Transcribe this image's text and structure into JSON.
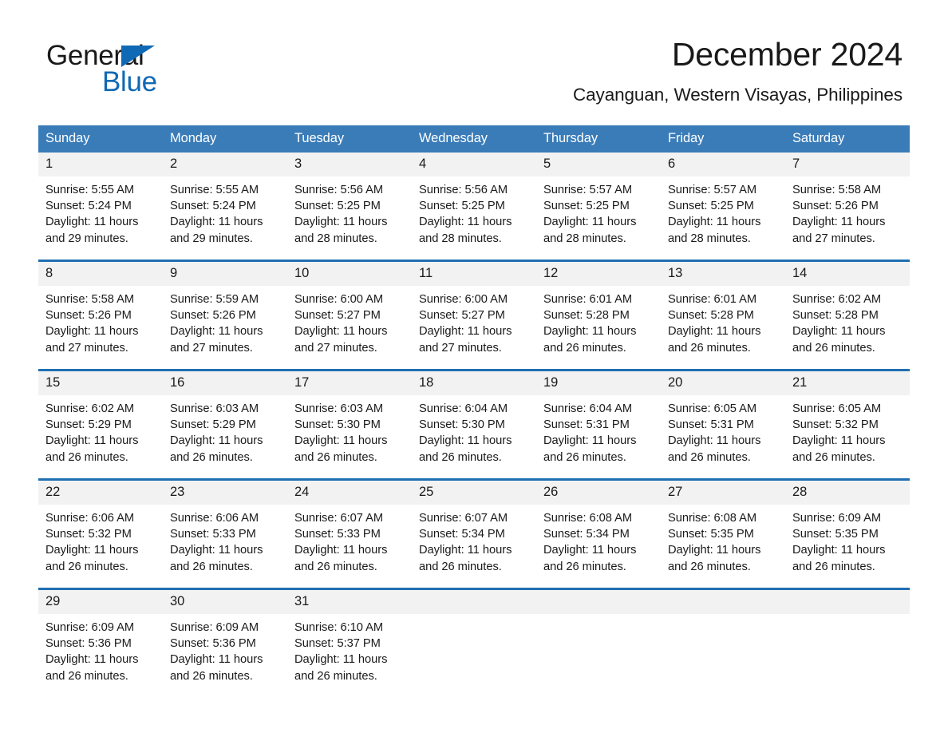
{
  "brand": {
    "name_part1": "General",
    "name_part2": "Blue",
    "accent_color": "#1069b4",
    "triangle_icon": "triangle-icon"
  },
  "header": {
    "month_title": "December 2024",
    "location": "Cayanguan, Western Visayas, Philippines"
  },
  "calendar": {
    "header_bg": "#3a7cb8",
    "row_divider_color": "#1f6fb2",
    "daynum_bg": "#f2f2f2",
    "weekdays": [
      "Sunday",
      "Monday",
      "Tuesday",
      "Wednesday",
      "Thursday",
      "Friday",
      "Saturday"
    ],
    "weeks": [
      [
        {
          "day": "1",
          "sunrise": "Sunrise: 5:55 AM",
          "sunset": "Sunset: 5:24 PM",
          "daylight_line1": "Daylight: 11 hours",
          "daylight_line2": "and 29 minutes."
        },
        {
          "day": "2",
          "sunrise": "Sunrise: 5:55 AM",
          "sunset": "Sunset: 5:24 PM",
          "daylight_line1": "Daylight: 11 hours",
          "daylight_line2": "and 29 minutes."
        },
        {
          "day": "3",
          "sunrise": "Sunrise: 5:56 AM",
          "sunset": "Sunset: 5:25 PM",
          "daylight_line1": "Daylight: 11 hours",
          "daylight_line2": "and 28 minutes."
        },
        {
          "day": "4",
          "sunrise": "Sunrise: 5:56 AM",
          "sunset": "Sunset: 5:25 PM",
          "daylight_line1": "Daylight: 11 hours",
          "daylight_line2": "and 28 minutes."
        },
        {
          "day": "5",
          "sunrise": "Sunrise: 5:57 AM",
          "sunset": "Sunset: 5:25 PM",
          "daylight_line1": "Daylight: 11 hours",
          "daylight_line2": "and 28 minutes."
        },
        {
          "day": "6",
          "sunrise": "Sunrise: 5:57 AM",
          "sunset": "Sunset: 5:25 PM",
          "daylight_line1": "Daylight: 11 hours",
          "daylight_line2": "and 28 minutes."
        },
        {
          "day": "7",
          "sunrise": "Sunrise: 5:58 AM",
          "sunset": "Sunset: 5:26 PM",
          "daylight_line1": "Daylight: 11 hours",
          "daylight_line2": "and 27 minutes."
        }
      ],
      [
        {
          "day": "8",
          "sunrise": "Sunrise: 5:58 AM",
          "sunset": "Sunset: 5:26 PM",
          "daylight_line1": "Daylight: 11 hours",
          "daylight_line2": "and 27 minutes."
        },
        {
          "day": "9",
          "sunrise": "Sunrise: 5:59 AM",
          "sunset": "Sunset: 5:26 PM",
          "daylight_line1": "Daylight: 11 hours",
          "daylight_line2": "and 27 minutes."
        },
        {
          "day": "10",
          "sunrise": "Sunrise: 6:00 AM",
          "sunset": "Sunset: 5:27 PM",
          "daylight_line1": "Daylight: 11 hours",
          "daylight_line2": "and 27 minutes."
        },
        {
          "day": "11",
          "sunrise": "Sunrise: 6:00 AM",
          "sunset": "Sunset: 5:27 PM",
          "daylight_line1": "Daylight: 11 hours",
          "daylight_line2": "and 27 minutes."
        },
        {
          "day": "12",
          "sunrise": "Sunrise: 6:01 AM",
          "sunset": "Sunset: 5:28 PM",
          "daylight_line1": "Daylight: 11 hours",
          "daylight_line2": "and 26 minutes."
        },
        {
          "day": "13",
          "sunrise": "Sunrise: 6:01 AM",
          "sunset": "Sunset: 5:28 PM",
          "daylight_line1": "Daylight: 11 hours",
          "daylight_line2": "and 26 minutes."
        },
        {
          "day": "14",
          "sunrise": "Sunrise: 6:02 AM",
          "sunset": "Sunset: 5:28 PM",
          "daylight_line1": "Daylight: 11 hours",
          "daylight_line2": "and 26 minutes."
        }
      ],
      [
        {
          "day": "15",
          "sunrise": "Sunrise: 6:02 AM",
          "sunset": "Sunset: 5:29 PM",
          "daylight_line1": "Daylight: 11 hours",
          "daylight_line2": "and 26 minutes."
        },
        {
          "day": "16",
          "sunrise": "Sunrise: 6:03 AM",
          "sunset": "Sunset: 5:29 PM",
          "daylight_line1": "Daylight: 11 hours",
          "daylight_line2": "and 26 minutes."
        },
        {
          "day": "17",
          "sunrise": "Sunrise: 6:03 AM",
          "sunset": "Sunset: 5:30 PM",
          "daylight_line1": "Daylight: 11 hours",
          "daylight_line2": "and 26 minutes."
        },
        {
          "day": "18",
          "sunrise": "Sunrise: 6:04 AM",
          "sunset": "Sunset: 5:30 PM",
          "daylight_line1": "Daylight: 11 hours",
          "daylight_line2": "and 26 minutes."
        },
        {
          "day": "19",
          "sunrise": "Sunrise: 6:04 AM",
          "sunset": "Sunset: 5:31 PM",
          "daylight_line1": "Daylight: 11 hours",
          "daylight_line2": "and 26 minutes."
        },
        {
          "day": "20",
          "sunrise": "Sunrise: 6:05 AM",
          "sunset": "Sunset: 5:31 PM",
          "daylight_line1": "Daylight: 11 hours",
          "daylight_line2": "and 26 minutes."
        },
        {
          "day": "21",
          "sunrise": "Sunrise: 6:05 AM",
          "sunset": "Sunset: 5:32 PM",
          "daylight_line1": "Daylight: 11 hours",
          "daylight_line2": "and 26 minutes."
        }
      ],
      [
        {
          "day": "22",
          "sunrise": "Sunrise: 6:06 AM",
          "sunset": "Sunset: 5:32 PM",
          "daylight_line1": "Daylight: 11 hours",
          "daylight_line2": "and 26 minutes."
        },
        {
          "day": "23",
          "sunrise": "Sunrise: 6:06 AM",
          "sunset": "Sunset: 5:33 PM",
          "daylight_line1": "Daylight: 11 hours",
          "daylight_line2": "and 26 minutes."
        },
        {
          "day": "24",
          "sunrise": "Sunrise: 6:07 AM",
          "sunset": "Sunset: 5:33 PM",
          "daylight_line1": "Daylight: 11 hours",
          "daylight_line2": "and 26 minutes."
        },
        {
          "day": "25",
          "sunrise": "Sunrise: 6:07 AM",
          "sunset": "Sunset: 5:34 PM",
          "daylight_line1": "Daylight: 11 hours",
          "daylight_line2": "and 26 minutes."
        },
        {
          "day": "26",
          "sunrise": "Sunrise: 6:08 AM",
          "sunset": "Sunset: 5:34 PM",
          "daylight_line1": "Daylight: 11 hours",
          "daylight_line2": "and 26 minutes."
        },
        {
          "day": "27",
          "sunrise": "Sunrise: 6:08 AM",
          "sunset": "Sunset: 5:35 PM",
          "daylight_line1": "Daylight: 11 hours",
          "daylight_line2": "and 26 minutes."
        },
        {
          "day": "28",
          "sunrise": "Sunrise: 6:09 AM",
          "sunset": "Sunset: 5:35 PM",
          "daylight_line1": "Daylight: 11 hours",
          "daylight_line2": "and 26 minutes."
        }
      ],
      [
        {
          "day": "29",
          "sunrise": "Sunrise: 6:09 AM",
          "sunset": "Sunset: 5:36 PM",
          "daylight_line1": "Daylight: 11 hours",
          "daylight_line2": "and 26 minutes."
        },
        {
          "day": "30",
          "sunrise": "Sunrise: 6:09 AM",
          "sunset": "Sunset: 5:36 PM",
          "daylight_line1": "Daylight: 11 hours",
          "daylight_line2": "and 26 minutes."
        },
        {
          "day": "31",
          "sunrise": "Sunrise: 6:10 AM",
          "sunset": "Sunset: 5:37 PM",
          "daylight_line1": "Daylight: 11 hours",
          "daylight_line2": "and 26 minutes."
        },
        {
          "day": "",
          "sunrise": "",
          "sunset": "",
          "daylight_line1": "",
          "daylight_line2": ""
        },
        {
          "day": "",
          "sunrise": "",
          "sunset": "",
          "daylight_line1": "",
          "daylight_line2": ""
        },
        {
          "day": "",
          "sunrise": "",
          "sunset": "",
          "daylight_line1": "",
          "daylight_line2": ""
        },
        {
          "day": "",
          "sunrise": "",
          "sunset": "",
          "daylight_line1": "",
          "daylight_line2": ""
        }
      ]
    ]
  }
}
